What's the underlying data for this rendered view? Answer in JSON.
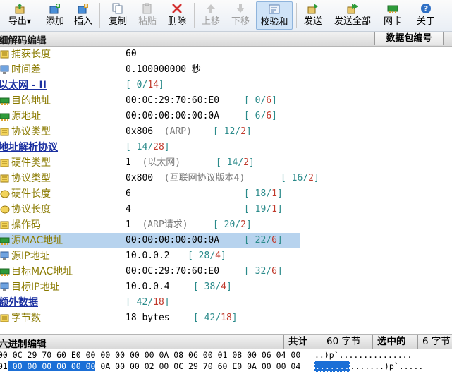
{
  "toolbar": {
    "export": "导出",
    "add": "添加",
    "insert": "插入",
    "copy": "复制",
    "paste": "粘贴",
    "delete": "删除",
    "move_up": "上移",
    "move_down": "下移",
    "checksum": "校验和",
    "send": "发送",
    "send_all": "发送全部",
    "nic": "网卡",
    "about": "关于"
  },
  "decode_panel": {
    "title": "细解码编辑",
    "packet_number_header": "数据包编号"
  },
  "tree": [
    {
      "name": "捕获长度",
      "value": "60",
      "anno": "",
      "off_a": "",
      "off_b": "",
      "section": false
    },
    {
      "name": "时间差",
      "value": "0.100000000 秒",
      "anno": "",
      "off_a": "",
      "off_b": "",
      "section": false
    },
    {
      "name": "以太网 - II",
      "value": "",
      "anno": "",
      "off_a": "0",
      "off_b": "14",
      "section": true
    },
    {
      "name": "目的地址",
      "value": "00:0C:29:70:60:E0",
      "anno": "",
      "off_a": "0",
      "off_b": "6",
      "section": false
    },
    {
      "name": "源地址",
      "value": "00:00:00:00:00:0A",
      "anno": "",
      "off_a": "6",
      "off_b": "6",
      "section": false
    },
    {
      "name": "协议类型",
      "value": "0x806",
      "anno": "(ARP)",
      "off_a": "12",
      "off_b": "2",
      "section": false
    },
    {
      "name": "地址解析协议",
      "value": "",
      "anno": "",
      "off_a": "14",
      "off_b": "28",
      "section": true
    },
    {
      "name": "硬件类型",
      "value": "1",
      "anno": "(以太网)",
      "off_a": "14",
      "off_b": "2",
      "section": false
    },
    {
      "name": "协议类型",
      "value": "0x800",
      "anno": "(互联网协议版本4)",
      "off_a": "16",
      "off_b": "2",
      "section": false
    },
    {
      "name": "硬件长度",
      "value": "6",
      "anno": "",
      "off_a": "18",
      "off_b": "1",
      "section": false
    },
    {
      "name": "协议长度",
      "value": "4",
      "anno": "",
      "off_a": "19",
      "off_b": "1",
      "section": false
    },
    {
      "name": "操作码",
      "value": "1",
      "anno": "(ARP请求)",
      "off_a": "20",
      "off_b": "2",
      "section": false
    },
    {
      "name": "源MAC地址",
      "value": "00:00:00:00:00:0A",
      "anno": "",
      "off_a": "22",
      "off_b": "6",
      "section": false
    },
    {
      "name": "源IP地址",
      "value": "10.0.0.2",
      "anno": "",
      "off_a": "28",
      "off_b": "4",
      "section": false
    },
    {
      "name": "目标MAC地址",
      "value": "00:0C:29:70:60:E0",
      "anno": "",
      "off_a": "32",
      "off_b": "6",
      "section": false
    },
    {
      "name": "目标IP地址",
      "value": "10.0.0.4",
      "anno": "",
      "off_a": "38",
      "off_b": "4",
      "section": false
    },
    {
      "name": "额外数据",
      "value": "",
      "anno": "",
      "off_a": "42",
      "off_b": "18",
      "section": true
    },
    {
      "name": "字节数",
      "value": "18 bytes",
      "anno": "",
      "off_a": "42",
      "off_b": "18",
      "section": false
    }
  ],
  "hex_panel": {
    "title": "六进制编辑",
    "total_label": "共计",
    "total_value": "60 字节",
    "selected_label": "选中的",
    "selected_value": "6 字节",
    "line1_prefix": "00",
    "line1_hex": " 0C 29 70 60 E0 00 00 00 00 00 0A 08 06 00 01 08 00 06 04 00",
    "line2_prefix": "01",
    "line2_hex_sel": " 00 00 00 00 00 00",
    "line2_hex_rest": " 0A 00 00 02 00 0C 29 70 60 E0 0A 00 00 04",
    "ascii1": "..)p`...............",
    "ascii2_sel": ".......",
    "ascii2_rest": ".......)p`....."
  },
  "colors": {
    "selected_row": "#b7d3ee",
    "hex_selection": "#1b6fd6",
    "field_name": "#8a7a00",
    "section_name": "#1a2fa0",
    "offset_start": "#2a8a8a",
    "offset_length": "#c0392b"
  }
}
